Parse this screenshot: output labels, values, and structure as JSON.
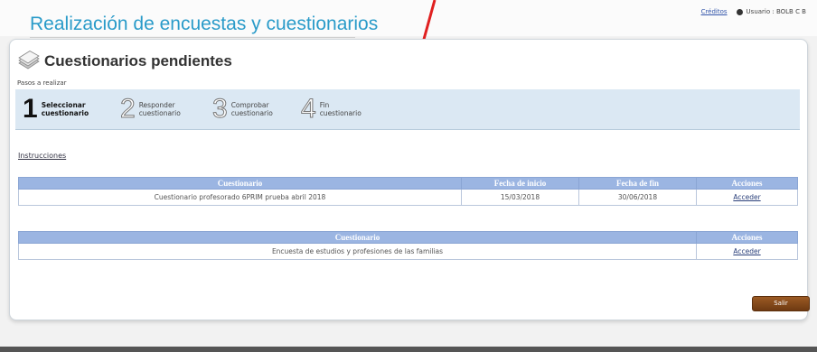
{
  "header": {
    "app_title": "Realización de encuestas y cuestionarios",
    "credits_link": "Créditos",
    "user_label": "Usuario : BOLB C B"
  },
  "page": {
    "title": "Cuestionarios pendientes",
    "steps_label": "Pasos a realizar",
    "steps": [
      {
        "number": "1",
        "label": "Seleccionar\ncuestionario",
        "active": true
      },
      {
        "number": "2",
        "label": "Responder\ncuestionario",
        "active": false
      },
      {
        "number": "3",
        "label": "Comprobar\ncuestionario",
        "active": false
      },
      {
        "number": "4",
        "label": "Fin\ncuestionario",
        "active": false
      }
    ],
    "instructions_link": "Instrucciones"
  },
  "questionnaires_table": {
    "headers": [
      "Cuestionario",
      "Fecha de inicio",
      "Fecha de fin",
      "Acciones"
    ],
    "rows": [
      {
        "name": "Cuestionario profesorado 6PRIM prueba abril 2018",
        "start": "15/03/2018",
        "end": "30/06/2018",
        "action": "Acceder"
      }
    ]
  },
  "surveys_table": {
    "headers": [
      "Cuestionario",
      "Acciones"
    ],
    "rows": [
      {
        "name": "Encuesta de estudios y profesiones de las familias",
        "action": "Acceder"
      }
    ]
  },
  "footer": {
    "exit_label": "Salir"
  },
  "colors": {
    "title_blue": "#2a9bc9",
    "table_header": "#9bb5e2",
    "steps_bg": "#dbe8f3",
    "exit_button": "#8a4a1a",
    "annotation_arrow": "#e02020"
  },
  "icons": {
    "page_icon": "stacked-documents-icon",
    "user_icon": "user-circle-icon",
    "annotation": "red-arrow-icon"
  }
}
